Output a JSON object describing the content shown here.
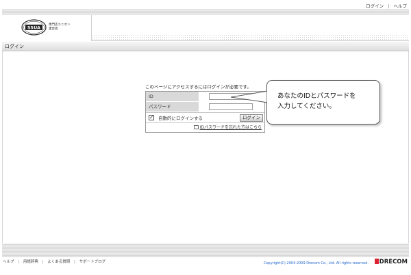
{
  "top_nav": {
    "login": "ログイン",
    "separator": "|",
    "help": "ヘルプ"
  },
  "logo": {
    "emblem": "SSUA",
    "line1": "専門店ユニオン",
    "line2": "連合会"
  },
  "breadcrumb": "ログイン",
  "login": {
    "notice": "このページにアクセスするにはログインが必要です。",
    "id_label": "ID",
    "id_value": "",
    "password_label": "パスワード",
    "password_value": "",
    "auto_login_label": "自動的にログインする",
    "auto_login_checked": "✓",
    "submit_label": "ログイン",
    "forgot_link": "IDパスワードを忘れた方はこちら"
  },
  "callout": {
    "line1": "あなたのIDとパスワードを",
    "line2": "入力してください。"
  },
  "footer": {
    "links": [
      "ヘルプ",
      "用語辞典",
      "よくある質問",
      "サポートブログ"
    ],
    "separator": "|",
    "copyright": "Copyright(C) 2004-2009 Drecom Co., Ltd. All rights reserved.",
    "brand": "DRECOM"
  }
}
